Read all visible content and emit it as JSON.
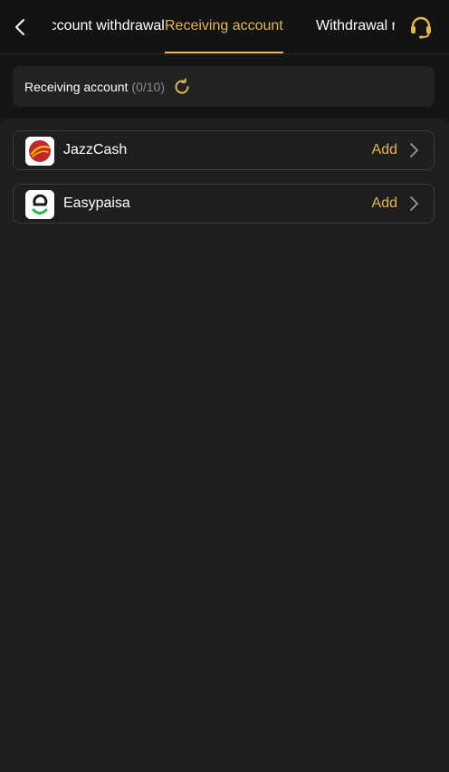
{
  "header": {
    "tabs": [
      {
        "label": "Account withdrawal",
        "active": false
      },
      {
        "label": "Receiving account",
        "active": true
      },
      {
        "label": "Withdrawal record",
        "active": false
      }
    ],
    "back_icon": "chevron-left-icon",
    "support_icon": "headset-icon"
  },
  "account_bar": {
    "label": "Receiving account",
    "count": "(0/10)",
    "refresh_icon": "refresh-icon"
  },
  "methods": [
    {
      "name": "JazzCash",
      "action": "Add",
      "logo_icon": "jazzcash-logo-icon"
    },
    {
      "name": "Easypaisa",
      "action": "Add",
      "logo_icon": "easypaisa-logo-icon"
    }
  ],
  "colors": {
    "accent": "#e3b54f",
    "background": "#151515",
    "panel": "#1e1e1e",
    "muted_text": "#8a8a8a"
  }
}
